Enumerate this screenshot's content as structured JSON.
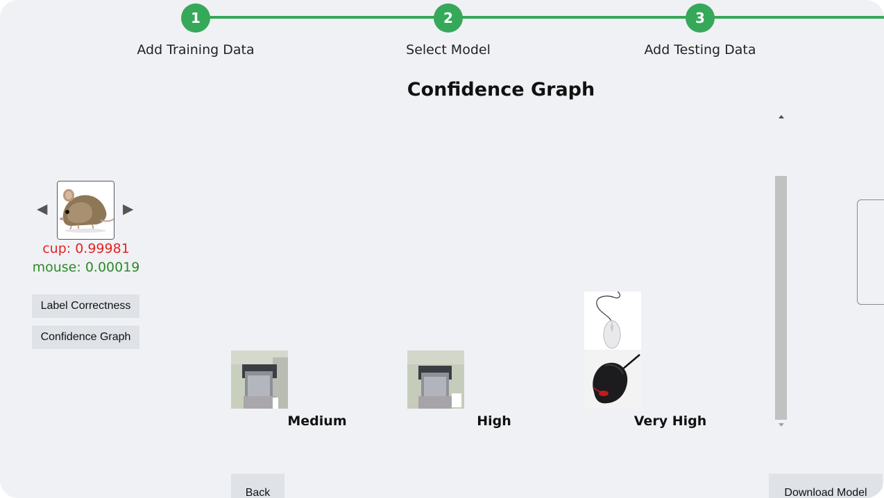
{
  "stepper": {
    "steps": [
      {
        "number": "1",
        "label": "Add Training Data"
      },
      {
        "number": "2",
        "label": "Select Model"
      },
      {
        "number": "3",
        "label": "Add Testing Data"
      }
    ],
    "color": "#36a85a"
  },
  "graph": {
    "title": "Confidence Graph",
    "columns": [
      {
        "label": "Medium",
        "images": [
          "face-photo"
        ]
      },
      {
        "label": "High",
        "images": [
          "face-photo"
        ]
      },
      {
        "label": "Very High",
        "images": [
          "white-mouse-photo",
          "black-mouse-photo"
        ]
      }
    ]
  },
  "viewer": {
    "current_image": "field-mouse-photo",
    "prev_icon": "triangle-left-icon",
    "next_icon": "triangle-right-icon",
    "scores": [
      {
        "text": "cup: 0.99981",
        "color": "#e52222"
      },
      {
        "text": "mouse: 0.00019",
        "color": "#2a8a2a"
      }
    ],
    "buttons": {
      "label_correctness": "Label Correctness",
      "confidence_graph": "Confidence Graph"
    }
  },
  "footer": {
    "back_label": "Back",
    "download_label": "Download Model"
  }
}
